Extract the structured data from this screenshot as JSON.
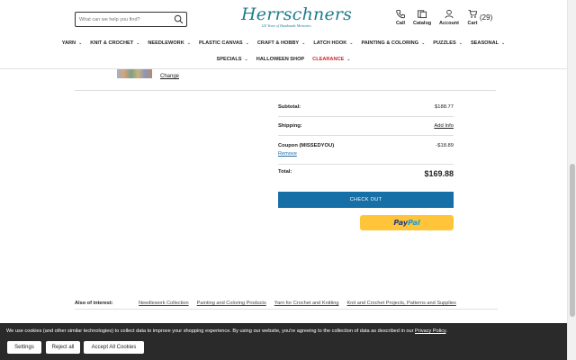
{
  "header": {
    "search_placeholder": "What can we help you find?",
    "logo_text": "Herrschners",
    "logo_tagline": "125 Years of Handmade Memories",
    "call_label": "Call",
    "catalog_label": "Catalog",
    "account_label": "Account",
    "cart_label": "Cart",
    "cart_count": "(29)"
  },
  "nav": {
    "row1": [
      "YARN",
      "KNIT & CROCHET",
      "NEEDLEWORK",
      "PLASTIC CANVAS",
      "CRAFT & HOBBY",
      "LATCH HOOK",
      "PAINTING & COLORING",
      "PUZZLES",
      "SEASONAL"
    ],
    "row2": [
      "SPECIALS",
      "HALLOWEEN SHOP",
      "CLEARANCE"
    ]
  },
  "product": {
    "change_label": "Change"
  },
  "summary": {
    "subtotal_label": "Subtotal:",
    "subtotal_value": "$188.77",
    "shipping_label": "Shipping:",
    "shipping_value": "Add Info",
    "coupon_label": "Coupon (MISSEDYOU)",
    "coupon_value": "-$18.89",
    "coupon_remove": "Remove",
    "total_label": "Total:",
    "total_value": "$169.88",
    "checkout_label": "CHECK OUT",
    "paypal_pay": "Pay",
    "paypal_pal": "Pal"
  },
  "also": {
    "heading": "Also of interest:",
    "links": [
      "Needlework Collection",
      "Painting and Coloring Products",
      "Yarn for Crochet and Knitting",
      "Knit and Crochet Projects, Patterns and Supplies"
    ]
  },
  "cookie": {
    "message": "We use cookies (and other similar technologies) to collect data to improve your shopping experience. By using our website, you're agreeing to the collection of data as described in our ",
    "policy_link": "Privacy Policy",
    "period": ".",
    "settings": "Settings",
    "reject": "Reject all",
    "accept": "Accept All Cookies"
  },
  "colors": {
    "brand_teal": "#1f7c8c",
    "checkout_blue": "#166fa6",
    "clearance_red": "#d2232a",
    "paypal_yellow": "#ffc439",
    "cookie_bg": "#2a2a2a"
  }
}
